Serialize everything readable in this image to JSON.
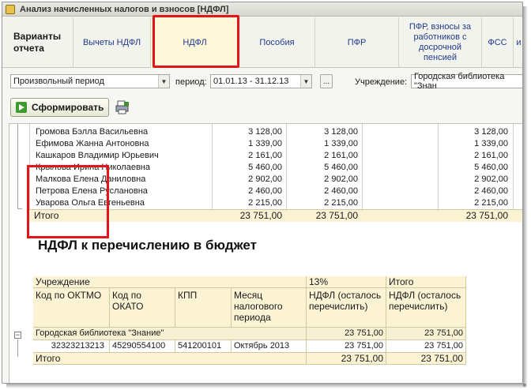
{
  "window": {
    "title": "Анализ начисленных налогов и взносов [НДФЛ]"
  },
  "tabs": [
    {
      "label": "Варианты отчета",
      "width": 90
    },
    {
      "label": "Вычеты НДФЛ",
      "width": 98
    },
    {
      "label": "НДФЛ",
      "width": 112
    },
    {
      "label": "Пособия",
      "width": 96
    },
    {
      "label": "ПФР",
      "width": 106
    },
    {
      "label": "ПФР, взносы за работников с досрочной пенсией",
      "width": 105
    },
    {
      "label": "ФСС",
      "width": 40
    },
    {
      "label": "и",
      "width": 13
    }
  ],
  "filter": {
    "period_type": "Произвольный период",
    "period_label": "период:",
    "period_value": "01.01.13 - 31.12.13",
    "dots_label": "...",
    "org_label": "Учреждение:",
    "org_value": "Городская библиотека \"Знан"
  },
  "toolbar": {
    "generate_label": "Сформировать"
  },
  "table1": {
    "rows": [
      {
        "name": "Громова Бэлла Васильевна",
        "c1": "3 128,00",
        "c2": "3 128,00",
        "c3": "3 128,00"
      },
      {
        "name": "Ефимова Жанна Антоновна",
        "c1": "1 339,00",
        "c2": "1 339,00",
        "c3": "1 339,00"
      },
      {
        "name": "Кашкаров Владимир Юрьевич",
        "c1": "2 161,00",
        "c2": "2 161,00",
        "c3": "2 161,00"
      },
      {
        "name": "Крылова Ирина Николаевна",
        "c1": "5 460,00",
        "c2": "5 460,00",
        "c3": "5 460,00"
      },
      {
        "name": "Малкова Елена Даниловна",
        "c1": "2 902,00",
        "c2": "2 902,00",
        "c3": "2 902,00"
      },
      {
        "name": "Петрова Елена Руслановна",
        "c1": "2 460,00",
        "c2": "2 460,00",
        "c3": "2 460,00"
      },
      {
        "name": "Уварова Ольга Евгеньевна",
        "c1": "2 215,00",
        "c2": "2 215,00",
        "c3": "2 215,00"
      }
    ],
    "total": {
      "label": "Итого",
      "c1": "23 751,00",
      "c2": "23 751,00",
      "c3": "23 751,00"
    }
  },
  "section_title": "НДФЛ к перечислению в бюджет",
  "table2": {
    "header_org": "Учреждение",
    "header_rate": "13%",
    "header_total": "Итого",
    "col_oktmo": "Код по ОКТМО",
    "col_okato": "Код по ОКАТО",
    "col_kpp": "КПП",
    "col_month": "Месяц налогового периода",
    "col_ndfl_rate": "НДФЛ (осталось перечислить)",
    "col_ndfl_total": "НДФЛ (осталось перечислить)",
    "group_row": {
      "org": "Городская библиотека \"Знание\"",
      "rate": "23 751,00",
      "total": "23 751,00"
    },
    "data_row": {
      "oktmo": "32323213213",
      "okato": "45290554100",
      "kpp": "541200101",
      "month": "Октябрь 2013",
      "rate": "23 751,00",
      "total": "23 751,00"
    },
    "total_row": {
      "label": "Итого",
      "rate": "23 751,00",
      "total": "23 751,00"
    }
  }
}
